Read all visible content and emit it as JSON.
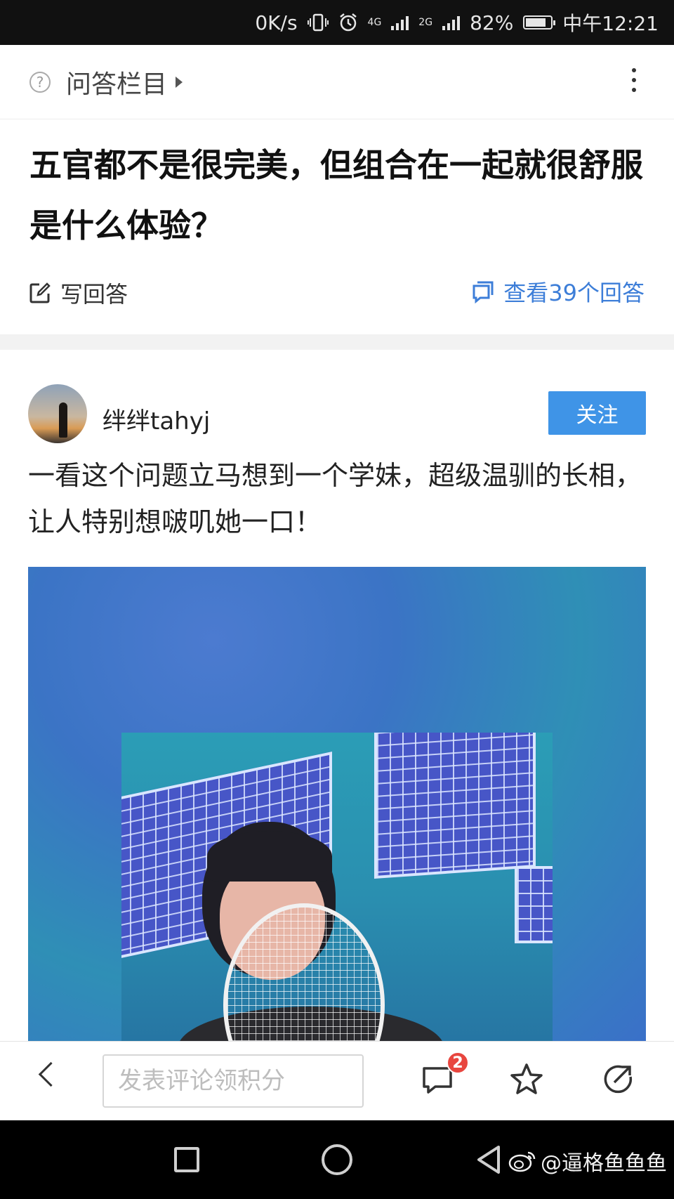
{
  "status_bar": {
    "speed": "0K/s",
    "net1": "4G",
    "net2": "2G",
    "battery": "82%",
    "battery_level": 0.82,
    "time": "中午12:21"
  },
  "header": {
    "section_title": "问答栏目"
  },
  "question": {
    "title": "五官都不是很完美，但组合在一起就很舒服是什么体验？",
    "write_answer": "写回答",
    "view_answers": "查看39个回答"
  },
  "answer": {
    "username": "绊绊tahyj",
    "follow_label": "关注",
    "text": "一看这个问题立马想到一个学妹，超级温驯的长相，让人特别想啵叽她一口！"
  },
  "toolbar": {
    "comment_placeholder": "发表评论领积分",
    "comment_badge": "2"
  },
  "watermark": {
    "text": "@逼格鱼鱼鱼"
  },
  "colors": {
    "accent": "#3f94e7",
    "link": "#3d7ed8",
    "badge": "#e8463f"
  }
}
